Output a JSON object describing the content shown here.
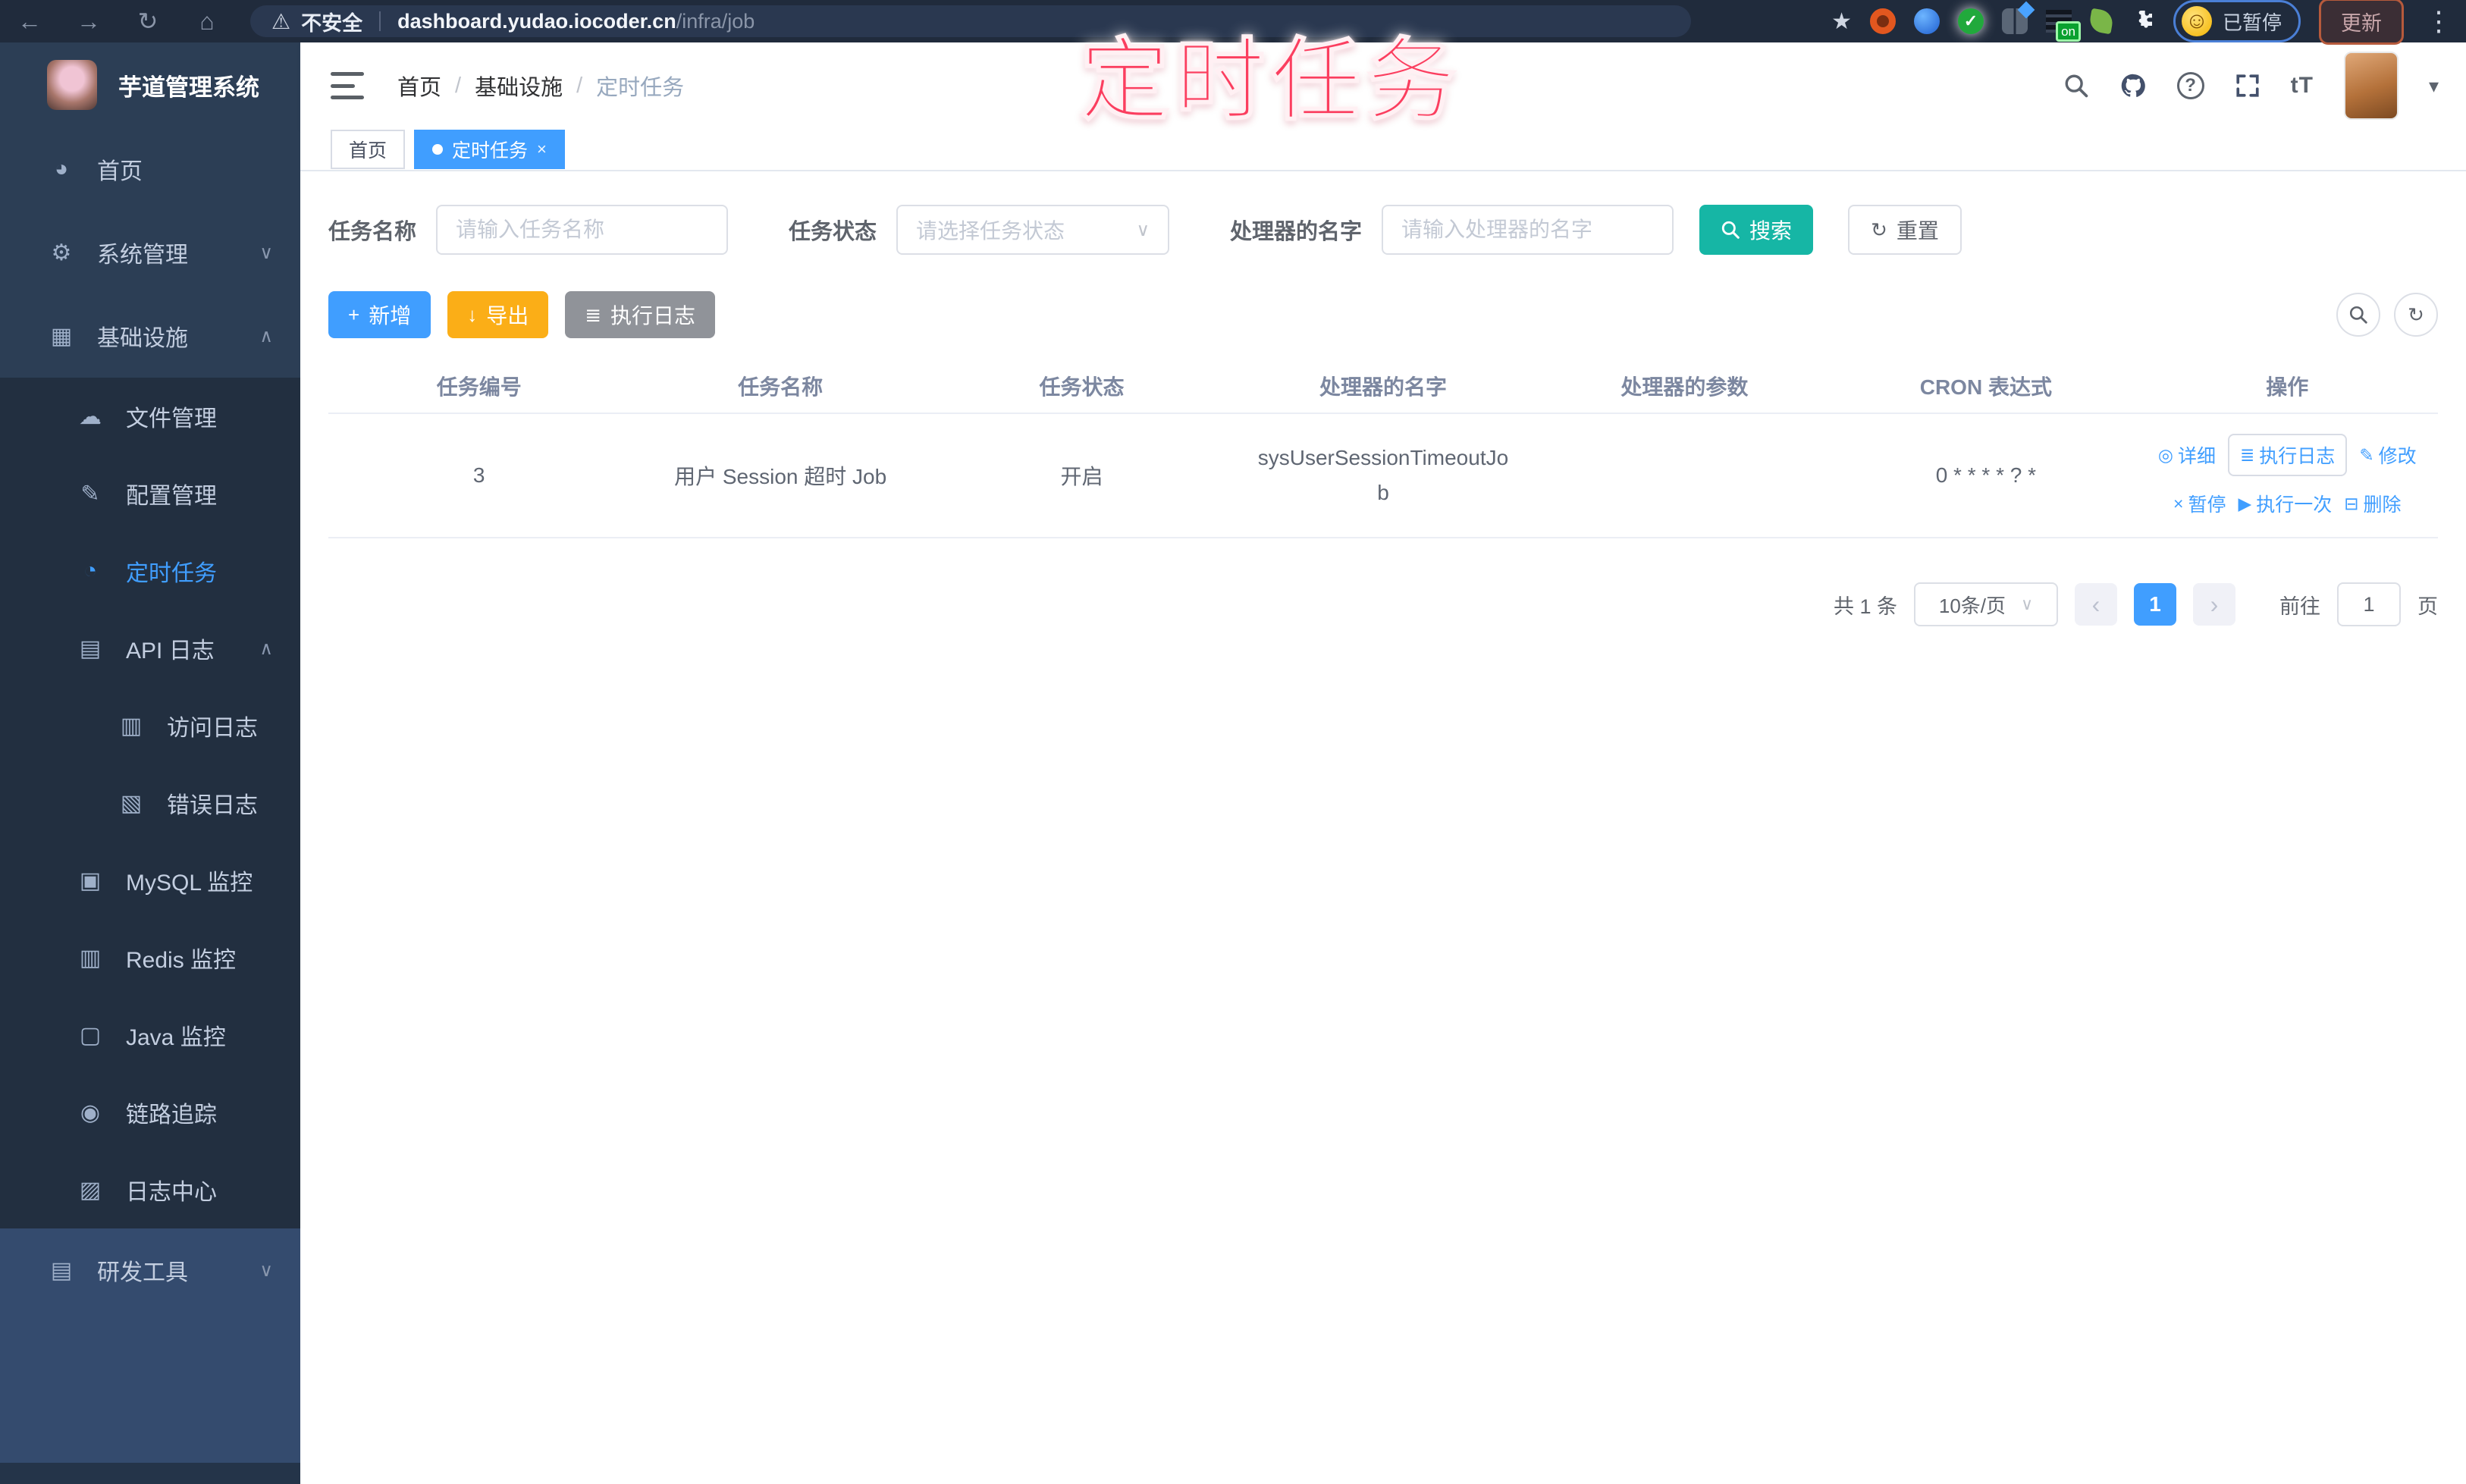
{
  "browser": {
    "security_label": "不安全",
    "url_host": "dashboard.yudao.iocoder.cn",
    "url_path": "/infra/job",
    "ext_on_badge": "on",
    "paused_label": "已暂停",
    "update_label": "更新"
  },
  "annotation": {
    "title": "定时任务"
  },
  "sidebar": {
    "logo_title": "芋道管理系统",
    "menu": [
      {
        "label": "首页"
      },
      {
        "label": "系统管理"
      },
      {
        "label": "基础设施"
      },
      {
        "label": "文件管理"
      },
      {
        "label": "配置管理"
      },
      {
        "label": "定时任务"
      },
      {
        "label": "API 日志"
      },
      {
        "label": "访问日志"
      },
      {
        "label": "错误日志"
      },
      {
        "label": "MySQL 监控"
      },
      {
        "label": "Redis 监控"
      },
      {
        "label": "Java 监控"
      },
      {
        "label": "链路追踪"
      },
      {
        "label": "日志中心"
      },
      {
        "label": "研发工具"
      }
    ]
  },
  "header": {
    "breadcrumb": [
      "首页",
      "基础设施",
      "定时任务"
    ],
    "breadcrumb_separator": "/",
    "help_glyph": "?",
    "font_icon_label": "tT"
  },
  "tabs": [
    {
      "label": "首页"
    },
    {
      "label": "定时任务",
      "close": "×"
    }
  ],
  "filters": {
    "name_label": "任务名称",
    "name_placeholder": "请输入任务名称",
    "status_label": "任务状态",
    "status_placeholder": "请选择任务状态",
    "handler_label": "处理器的名字",
    "handler_placeholder": "请输入处理器的名字",
    "search_label": "搜索",
    "reset_label": "重置"
  },
  "toolbar": {
    "add_label": "新增",
    "export_label": "导出",
    "log_label": "执行日志"
  },
  "table": {
    "headers": [
      "任务编号",
      "任务名称",
      "任务状态",
      "处理器的名字",
      "处理器的参数",
      "CRON 表达式",
      "操作"
    ],
    "rows": [
      {
        "id": "3",
        "name": "用户 Session 超时 Job",
        "status": "开启",
        "handler": "sysUserSessionTimeoutJob",
        "param": "",
        "cron": "0 * * * * ? *"
      }
    ],
    "actions": {
      "detail": "详细",
      "exec_log": "执行日志",
      "edit": "修改",
      "pause": "暂停",
      "run_once": "执行一次",
      "delete": "删除"
    }
  },
  "pagination": {
    "total": "共 1 条",
    "page_size": "10条/页",
    "prev": "‹",
    "page": "1",
    "next": "›",
    "goto_label": "前往",
    "goto_value": "1",
    "goto_unit": "页"
  }
}
